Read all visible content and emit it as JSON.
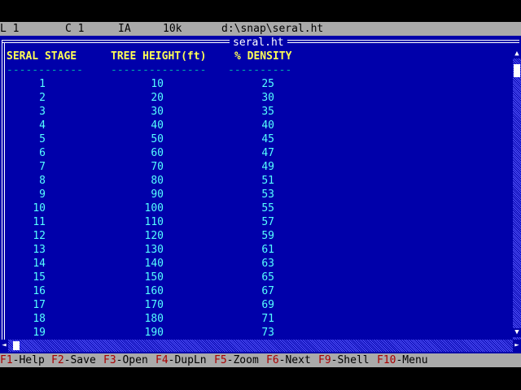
{
  "status": {
    "line": "L 1",
    "col": "C 1",
    "mode": "IA",
    "size": "10k",
    "path": "d:\\snap\\seral.ht"
  },
  "window": {
    "title": "seral.ht"
  },
  "table": {
    "headers": [
      "SERAL STAGE",
      "TREE HEIGHT(ft)",
      "% DENSITY"
    ],
    "underlines": [
      "------------",
      "---------------",
      "----------"
    ],
    "rows": [
      [
        "1",
        "10",
        "25"
      ],
      [
        "2",
        "20",
        "30"
      ],
      [
        "3",
        "30",
        "35"
      ],
      [
        "4",
        "40",
        "40"
      ],
      [
        "5",
        "50",
        "45"
      ],
      [
        "6",
        "60",
        "47"
      ],
      [
        "7",
        "70",
        "49"
      ],
      [
        "8",
        "80",
        "51"
      ],
      [
        "9",
        "90",
        "53"
      ],
      [
        "10",
        "100",
        "55"
      ],
      [
        "11",
        "110",
        "57"
      ],
      [
        "12",
        "120",
        "59"
      ],
      [
        "13",
        "130",
        "61"
      ],
      [
        "14",
        "140",
        "63"
      ],
      [
        "15",
        "150",
        "65"
      ],
      [
        "16",
        "160",
        "67"
      ],
      [
        "17",
        "170",
        "69"
      ],
      [
        "18",
        "180",
        "71"
      ],
      [
        "19",
        "190",
        "73"
      ]
    ]
  },
  "scrollbars": {
    "up_arrow": "▲",
    "down_arrow": "▼",
    "left_arrow": "◄",
    "right_arrow": "►",
    "up_icon": "triangle-up-icon",
    "down_icon": "triangle-down-icon",
    "left_icon": "triangle-left-icon",
    "right_icon": "triangle-right-icon"
  },
  "function_keys": [
    {
      "key": "F1",
      "label": "-Help"
    },
    {
      "key": "F2",
      "label": "-Save"
    },
    {
      "key": "F3",
      "label": "-Open"
    },
    {
      "key": "F4",
      "label": "-DupLn"
    },
    {
      "key": "F5",
      "label": "-Zoom"
    },
    {
      "key": "F6",
      "label": "-Next"
    },
    {
      "key": "F9",
      "label": "-Shell"
    },
    {
      "key": "F10",
      "label": "-Menu"
    }
  ],
  "colors": {
    "background": "#0000aa",
    "header_text": "#ffff55",
    "cell_text": "#55ffff",
    "status_bar": "#aaaaaa",
    "fkey_key": "#aa0000"
  }
}
